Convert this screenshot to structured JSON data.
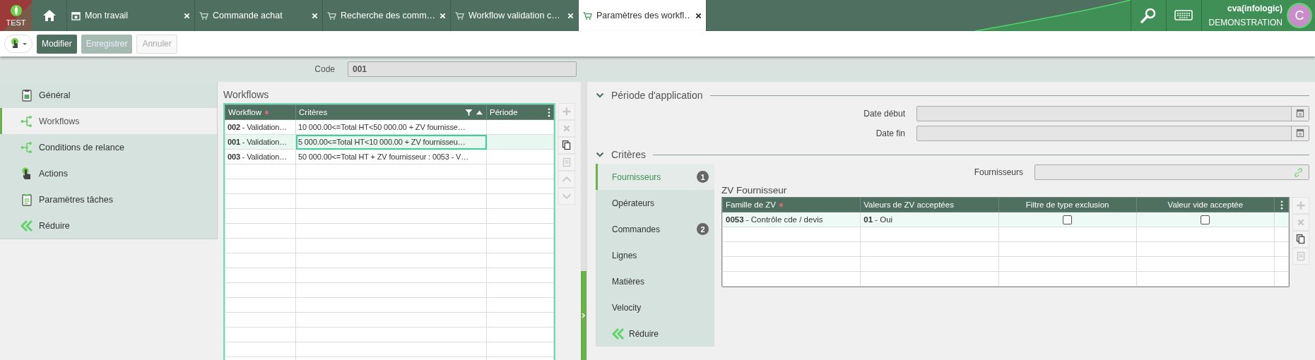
{
  "environment": {
    "label": "TEST"
  },
  "tabs": [
    {
      "label": "Mon travail",
      "selected": false
    },
    {
      "label": "Commande achat",
      "selected": false
    },
    {
      "label": "Recherche des comm…",
      "selected": false
    },
    {
      "label": "Workflow validation c…",
      "selected": false
    },
    {
      "label": "Paramètres des workfl…",
      "selected": true
    }
  ],
  "user": {
    "name": "cva(infologic)",
    "company": "DEMONSTRATION",
    "avatar_letter": "C"
  },
  "toolbar": {
    "buttons": [
      {
        "label": "Modifier",
        "kind": "primary",
        "disabled": false
      },
      {
        "label": "Enregistrer",
        "kind": "primary",
        "disabled": true
      },
      {
        "label": "Annuler",
        "kind": "plain",
        "disabled": true
      }
    ]
  },
  "code": {
    "label": "Code",
    "value": "001"
  },
  "sidebar": {
    "items": [
      {
        "label": "Général",
        "selected": false
      },
      {
        "label": "Workflows",
        "selected": true
      },
      {
        "label": "Conditions de relance",
        "selected": false
      },
      {
        "label": "Actions",
        "selected": false
      },
      {
        "label": "Paramètres tâches",
        "selected": false
      }
    ],
    "collapse_label": "Réduire"
  },
  "workflows": {
    "title": "Workflows",
    "columns": [
      {
        "label": "Workflow",
        "required": true,
        "filtered": false,
        "sorted": false
      },
      {
        "label": "Critères",
        "required": false,
        "filtered": true,
        "sorted": true
      },
      {
        "label": "Période",
        "required": false,
        "filtered": false,
        "sorted": false
      }
    ],
    "rows": [
      {
        "workflow": "**002** - Validation…",
        "criteria": "10 000.00<=Total HT<50 000.00 + ZV fournisse…",
        "selected": false
      },
      {
        "workflow": "**001** - Validation…",
        "criteria": "5 000.00<=Total HT<10 000.00 + ZV fournisseu…",
        "selected": true
      },
      {
        "workflow": "**003** - Validation…",
        "criteria": "50 000.00<=Total HT + ZV fournisseur : 0053 - V…",
        "selected": false
      }
    ]
  },
  "period": {
    "title": "Période d'application",
    "expanded": true,
    "fields": [
      {
        "label": "Date début"
      },
      {
        "label": "Date fin"
      }
    ]
  },
  "criteria": {
    "title": "Critères",
    "expanded": true,
    "tabs": [
      {
        "label": "Fournisseurs",
        "count": "1",
        "selected": true
      },
      {
        "label": "Opérateurs",
        "selected": false
      },
      {
        "label": "Commandes",
        "count": "2",
        "selected": false
      },
      {
        "label": "Lignes",
        "selected": false
      },
      {
        "label": "Matières",
        "selected": false
      },
      {
        "label": "Velocity",
        "selected": false
      }
    ],
    "collapse_label": "Réduire",
    "supplier_field": {
      "label": "Fournisseurs"
    },
    "zv": {
      "title": "ZV Fournisseur",
      "columns": [
        {
          "label": "Famille de ZV",
          "required": true
        },
        {
          "label": "Valeurs de ZV acceptées",
          "required": false
        },
        {
          "label": "Filtre de type exclusion",
          "required": false
        },
        {
          "label": "Valeur vide acceptée",
          "required": false
        }
      ],
      "rows": [
        {
          "family": "**0053** - Contrôle cde / devis",
          "value": "**01** - Oui",
          "exclusion": false,
          "empty_accepted": false
        }
      ]
    }
  }
}
